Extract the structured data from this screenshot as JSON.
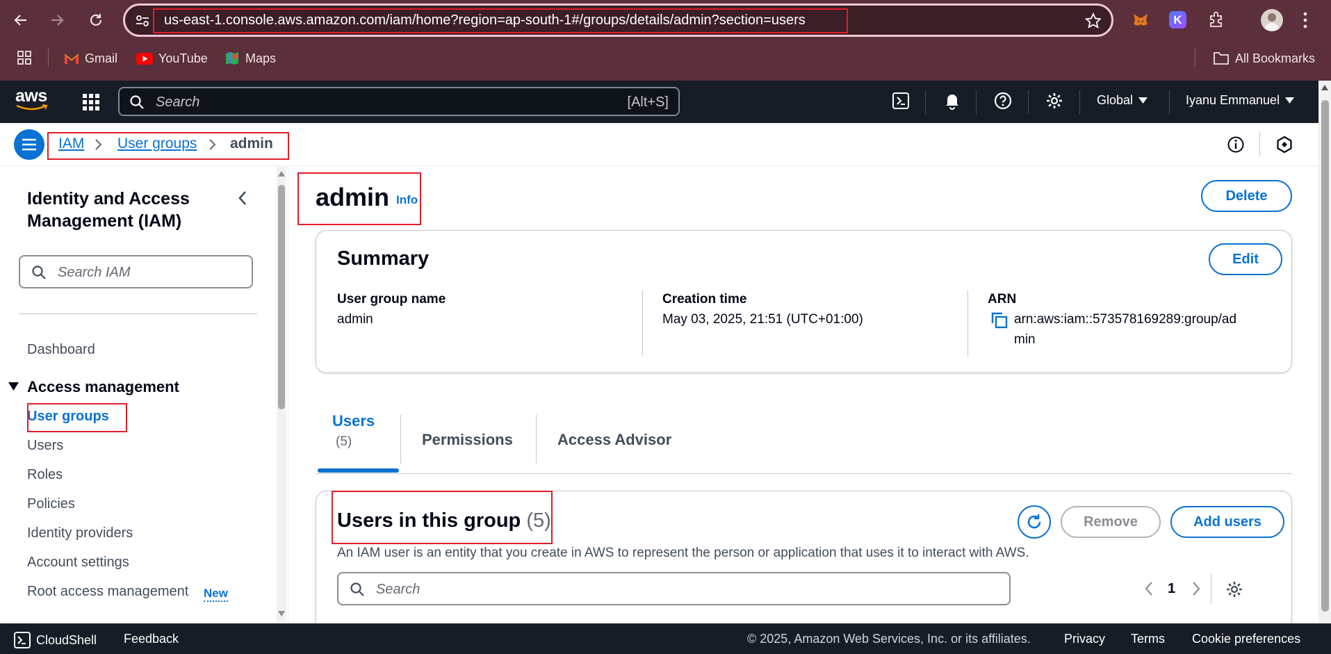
{
  "browser": {
    "url": "us-east-1.console.aws.amazon.com/iam/home?region=ap-south-1#/groups/details/admin?section=users",
    "bookmarks": [
      "Gmail",
      "YouTube",
      "Maps"
    ],
    "all_bookmarks": "All Bookmarks",
    "extension_badge": "K"
  },
  "aws": {
    "logo": "aws",
    "search_placeholder": "Search",
    "search_shortcut": "[Alt+S]",
    "region": "Global",
    "account": "Iyanu Emmanuel"
  },
  "breadcrumb": {
    "items": [
      "IAM",
      "User groups",
      "admin"
    ]
  },
  "sidebar": {
    "title": "Identity and Access Management (IAM)",
    "search_placeholder": "Search IAM",
    "dashboard": "Dashboard",
    "section": "Access management",
    "items": [
      "User groups",
      "Users",
      "Roles",
      "Policies",
      "Identity providers",
      "Account settings",
      "Root access management"
    ],
    "new_badge": "New"
  },
  "page": {
    "title": "admin",
    "info": "Info",
    "delete": "Delete"
  },
  "summary": {
    "heading": "Summary",
    "edit": "Edit",
    "group_name_label": "User group name",
    "group_name": "admin",
    "creation_label": "Creation time",
    "creation_time": "May 03, 2025, 21:51 (UTC+01:00)",
    "arn_label": "ARN",
    "arn_line1": "arn:aws:iam::573578169289:group/ad",
    "arn_line2": "min"
  },
  "tabs": {
    "users": "Users",
    "users_count": "(5)",
    "permissions": "Permissions",
    "access_advisor": "Access Advisor"
  },
  "users_panel": {
    "heading": "Users in this group",
    "count": "(5)",
    "description": "An IAM user is an entity that you create in AWS to represent the person or application that uses it to interact with AWS.",
    "remove": "Remove",
    "add_users": "Add users",
    "search_placeholder": "Search",
    "page": "1"
  },
  "footer": {
    "cloudshell": "CloudShell",
    "feedback": "Feedback",
    "copyright": "© 2025, Amazon Web Services, Inc. or its affiliates.",
    "privacy": "Privacy",
    "terms": "Terms",
    "cookies": "Cookie preferences"
  },
  "colors": {
    "accent": "#0972d3",
    "highlight_box": "#e21d2a",
    "chrome": "#5b2f3b",
    "aws_header": "#161d26"
  }
}
